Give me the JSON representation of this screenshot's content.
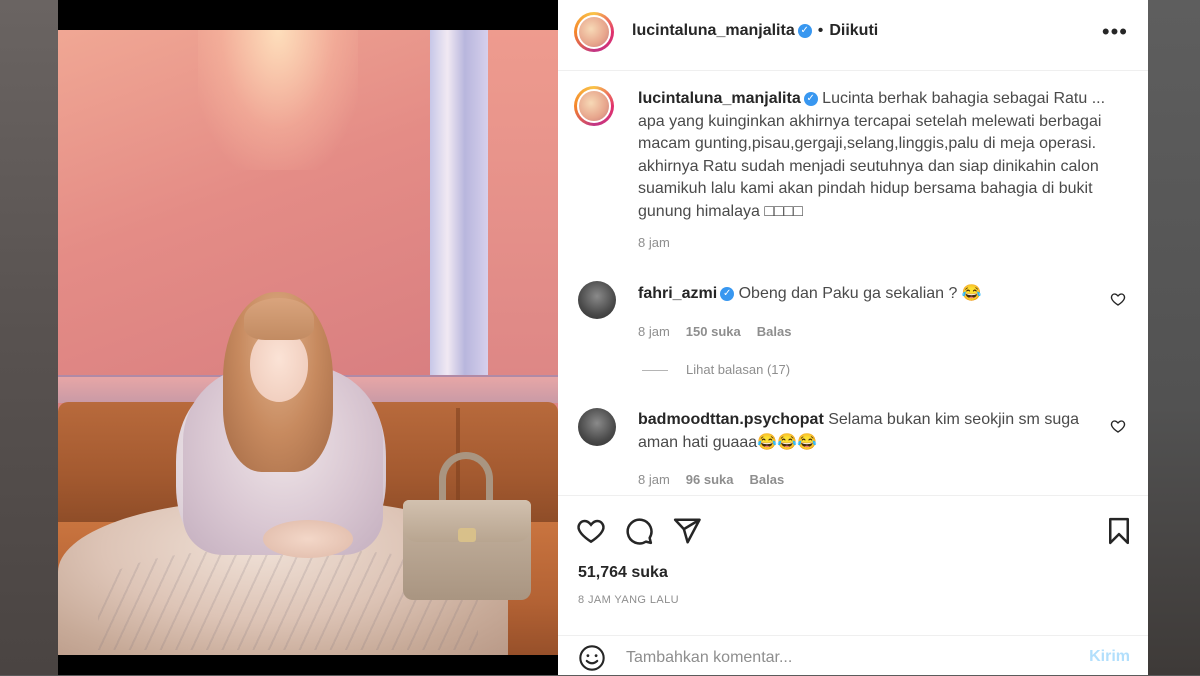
{
  "post": {
    "author": "lucintaluna_manjalita",
    "follow_status": "Diikuti",
    "more_icon": "more-horizontal-icon",
    "caption": {
      "username": "lucintaluna_manjalita",
      "text": "Lucinta berhak bahagia sebagai Ratu ... apa yang kuinginkan akhirnya tercapai setelah melewati berbagai macam gunting,pisau,gergaji,selang,linggis,palu di meja operasi. akhirnya Ratu sudah menjadi seutuhnya dan siap dinikahin calon suamikuh lalu kami akan pindah hidup bersama bahagia di bukit gunung himalaya □□□□",
      "time": "8 jam"
    },
    "comments": [
      {
        "username": "fahri_azmi",
        "verified": true,
        "text": "Obeng dan Paku ga sekalian ? 😂",
        "time": "8 jam",
        "likes": "150 suka",
        "reply_label": "Balas"
      },
      {
        "username": "badmoodttan.psychopat",
        "verified": false,
        "text": "Selama bukan kim seokjin sm suga aman hati guaaa😂😂😂",
        "time": "8 jam",
        "likes": "96 suka",
        "reply_label": "Balas"
      }
    ],
    "view_replies": "Lihat balasan (17)",
    "likes_count": "51,764 suka",
    "time_ago": "8 JAM YANG LALU",
    "comment_placeholder": "Tambahkan komentar...",
    "post_button": "Kirim"
  },
  "colors": {
    "verified_blue": "#3897f0",
    "post_button_disabled": "#b2dffc",
    "muted_text": "#8e8e8e",
    "primary_text": "#262626"
  }
}
